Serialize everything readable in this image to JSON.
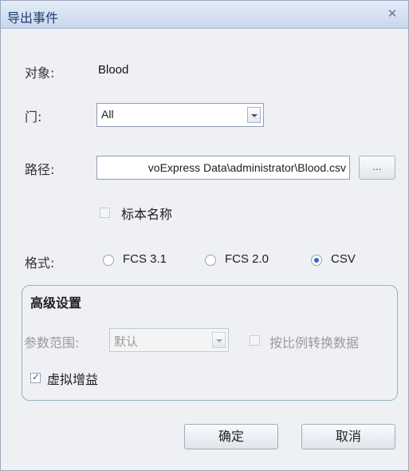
{
  "dialog": {
    "title": "导出事件",
    "close_icon": "close-icon"
  },
  "object": {
    "label": "对象:",
    "value": "Blood"
  },
  "gate": {
    "label": "门:",
    "value": "All"
  },
  "path": {
    "label": "路径:",
    "value": "voExpress Data\\administrator\\Blood.csv",
    "browse_label": "..."
  },
  "sample_name": {
    "label": "标本名称",
    "checked": false,
    "enabled": false
  },
  "format": {
    "label": "格式:",
    "options": [
      {
        "label": "FCS 3.1",
        "selected": false
      },
      {
        "label": "FCS 2.0",
        "selected": false
      },
      {
        "label": "CSV",
        "selected": true
      }
    ]
  },
  "advanced": {
    "title": "高级设置",
    "param_range_label": "参数范围:",
    "param_range_value": "默认",
    "scale_label": "按比例转换数据",
    "scale_checked": false,
    "virtual_gain_label": "虚拟增益",
    "virtual_gain_checked": true
  },
  "buttons": {
    "ok": "确定",
    "cancel": "取消"
  },
  "colors": {
    "radio_selected": "#2f6bc7",
    "title_text": "#1e3e6e"
  }
}
